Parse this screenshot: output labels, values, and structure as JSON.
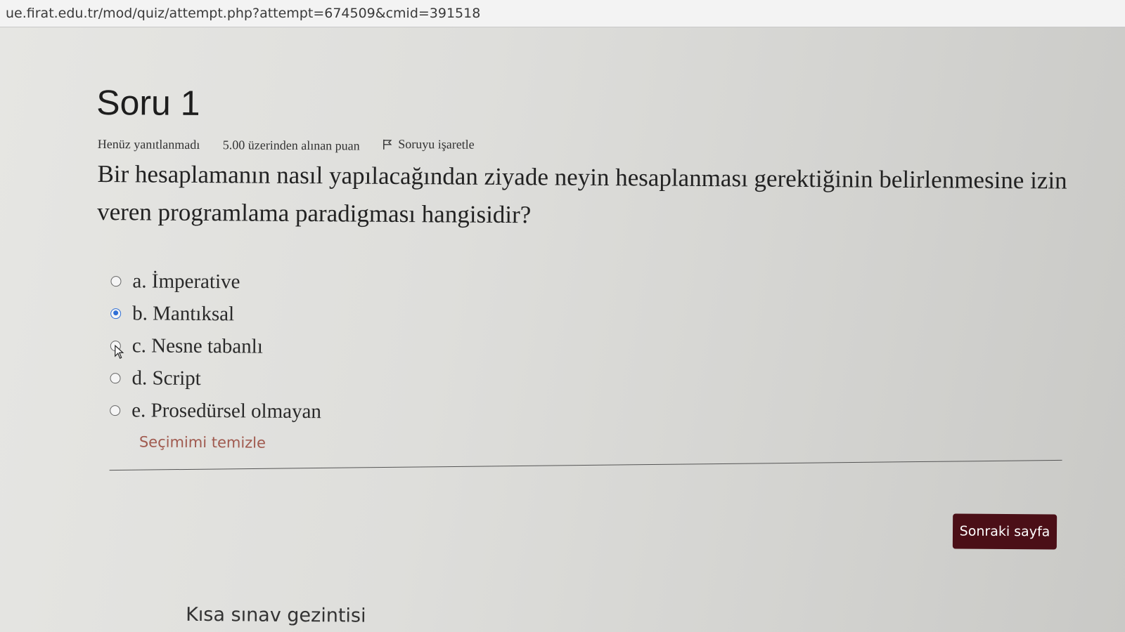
{
  "browser": {
    "url": "ue.firat.edu.tr/mod/quiz/attempt.php?attempt=674509&cmid=391518"
  },
  "question": {
    "title": "Soru 1",
    "status": "Henüz yanıtlanmadı",
    "grade": "5.00 üzerinden alınan puan",
    "flag_label": "Soruyu işaretle",
    "text": "Bir hesaplamanın nasıl yapılacağından ziyade neyin hesaplanması gerektiğinin belirlenmesine izin veren programlama paradigması hangisidir?",
    "answers": [
      {
        "label": "a. İmperative",
        "selected": false
      },
      {
        "label": "b. Mantıksal",
        "selected": true
      },
      {
        "label": "c. Nesne tabanlı",
        "selected": false
      },
      {
        "label": "d. Script",
        "selected": false
      },
      {
        "label": "e. Prosedürsel olmayan",
        "selected": false
      }
    ],
    "clear_choice": "Seçimimi temizle"
  },
  "navigation": {
    "next_button": "Sonraki sayfa",
    "quiz_nav_title": "Kısa sınav gezintisi"
  },
  "colors": {
    "selected_radio": "#2f6fd6",
    "next_button_bg": "#4b0f17",
    "link": "#a05a4f"
  }
}
